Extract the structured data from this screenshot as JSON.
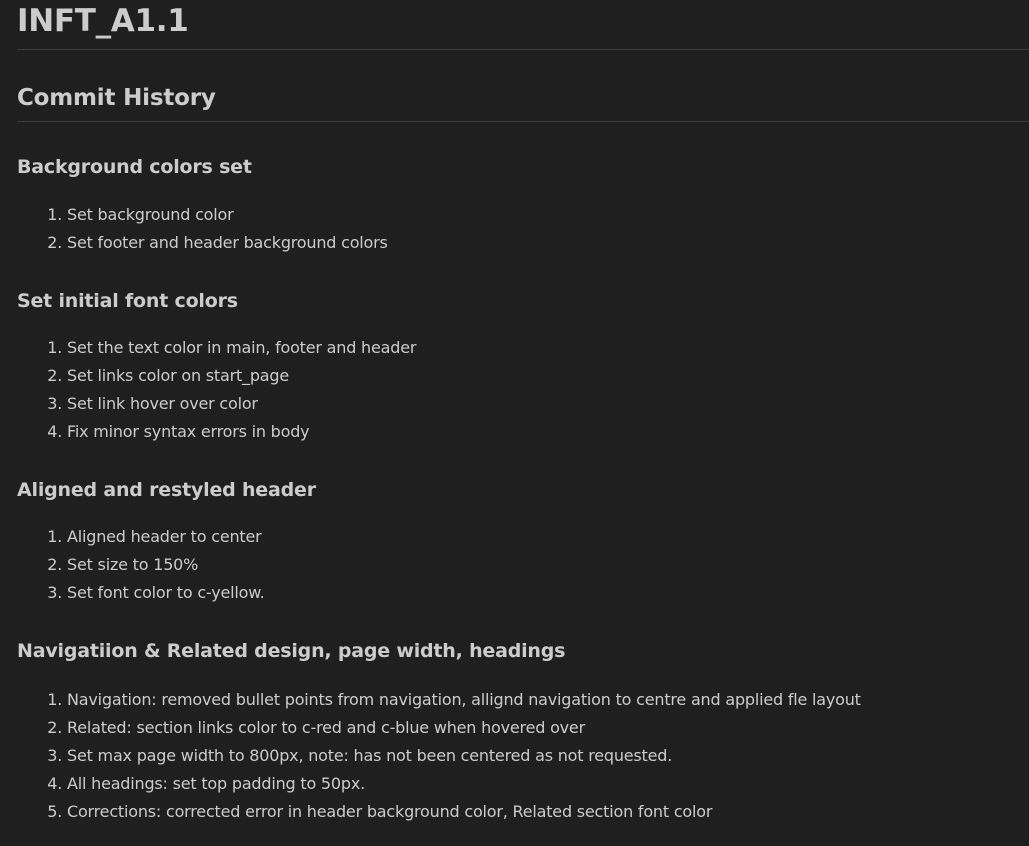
{
  "title": "INFT_A1.1",
  "commit_history_heading": "Commit History",
  "sections": [
    {
      "heading": "Background colors set",
      "items": [
        "Set background color",
        "Set footer and header background colors"
      ]
    },
    {
      "heading": "Set initial font colors",
      "items": [
        "Set the text color in main, footer and header",
        "Set links color on start_page",
        "Set link hover over color",
        "Fix minor syntax errors in body"
      ]
    },
    {
      "heading": "Aligned and restyled header",
      "items": [
        "Aligned header to center",
        "Set size to 150%",
        "Set font color to c-yellow."
      ]
    },
    {
      "heading": "Navigatiion & Related design, page width, headings",
      "items": [
        "Navigation: removed bullet points from navigation, allignd navigation to centre and applied fle layout",
        "Related: section links color to c-red and c-blue when hovered over",
        "Set max page width to 800px, note: has not been centered as not requested.",
        "All headings: set top padding to 50px.",
        "Corrections: corrected error in header background color, Related section font color"
      ]
    }
  ]
}
